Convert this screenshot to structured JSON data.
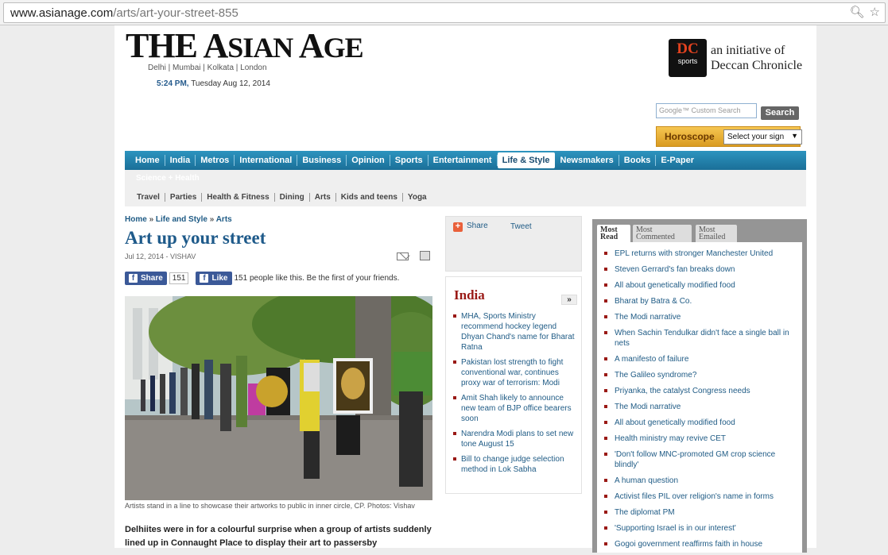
{
  "browser": {
    "url_domain": "www.asianage.com",
    "url_path": "/arts/art-your-street-855",
    "zoom_icon": "zoom-icon",
    "bookmark_icon": "star-icon"
  },
  "masthead": {
    "logo": "The Asian Age",
    "cities": "Delhi  |  Mumbai  |  Kolkata  |  London",
    "time": "5:24 PM,",
    "date": "Tuesday Aug 12, 2014",
    "dc_badge": "DC",
    "dc_badge_sub": "sports",
    "initiative_line1": "an initiative of",
    "initiative_line2": "Deccan Chronicle"
  },
  "search": {
    "placeholder": "Google™ Custom Search",
    "button": "Search"
  },
  "horoscope": {
    "label": "Horoscope",
    "select_value": "Select your sign"
  },
  "nav": {
    "items": [
      "Home",
      "India",
      "Metros",
      "International",
      "Business",
      "Opinion",
      "Sports",
      "Entertainment",
      "Life & Style",
      "Newsmakers",
      "Books",
      "E-Paper"
    ],
    "active": "Life & Style",
    "ghost_item": "Science + Health",
    "sub_items": [
      "Travel",
      "Parties",
      "Health & Fitness",
      "Dining",
      "Arts",
      "Kids and teens",
      "Yoga"
    ]
  },
  "article": {
    "breadcrumb": [
      "Home",
      "Life and Style",
      "Arts"
    ],
    "breadcrumb_sep": "»",
    "title": "Art up your street",
    "dateline": "Jul 12, 2014 - VISHAV",
    "fb_share": "Share",
    "fb_share_count": "151",
    "fb_like": "Like",
    "fb_text": "151 people like this. Be the first of your friends.",
    "caption": "Artists stand in a line to showcase their artworks to public in inner circle, CP. Photos: Vishav",
    "lede": "Delhiites were in for a colourful surprise when a group of artists suddenly lined up in Connaught Place to display their art to passersby"
  },
  "share": {
    "share_label": "Share",
    "tweet_label": "Tweet"
  },
  "india": {
    "title": "India",
    "more": "»",
    "items": [
      "MHA, Sports Ministry recommend hockey legend Dhyan Chand's name for Bharat Ratna",
      "Pakistan lost strength to fight conventional war, continues proxy war of terrorism: Modi",
      "Amit Shah likely to announce new team of BJP office bearers soon",
      "Narendra Modi plans to set new tone August 15",
      "Bill to change judge selection method in Lok Sabha"
    ]
  },
  "most": {
    "tabs": [
      "Most Read",
      "Most Commented",
      "Most Emailed"
    ],
    "items": [
      "EPL returns with stronger Manchester United",
      "Steven Gerrard's fan breaks down",
      "All about genetically modified food",
      "Bharat by Batra & Co.",
      "The Modi narrative",
      "When Sachin Tendulkar didn't face a single ball in nets",
      "A manifesto of failure",
      "The Galileo syndrome?",
      "Priyanka, the catalyst Congress needs",
      "The Modi narrative",
      "All about genetically modified food",
      "Health ministry may revive CET",
      "'Don't follow MNC-promoted GM crop science blindly'",
      "A human question",
      "Activist files PIL over religion's name in forms",
      "The diplomat PM",
      "'Supporting Israel is in our interest'",
      "Gogoi government reaffirms faith in house"
    ]
  }
}
